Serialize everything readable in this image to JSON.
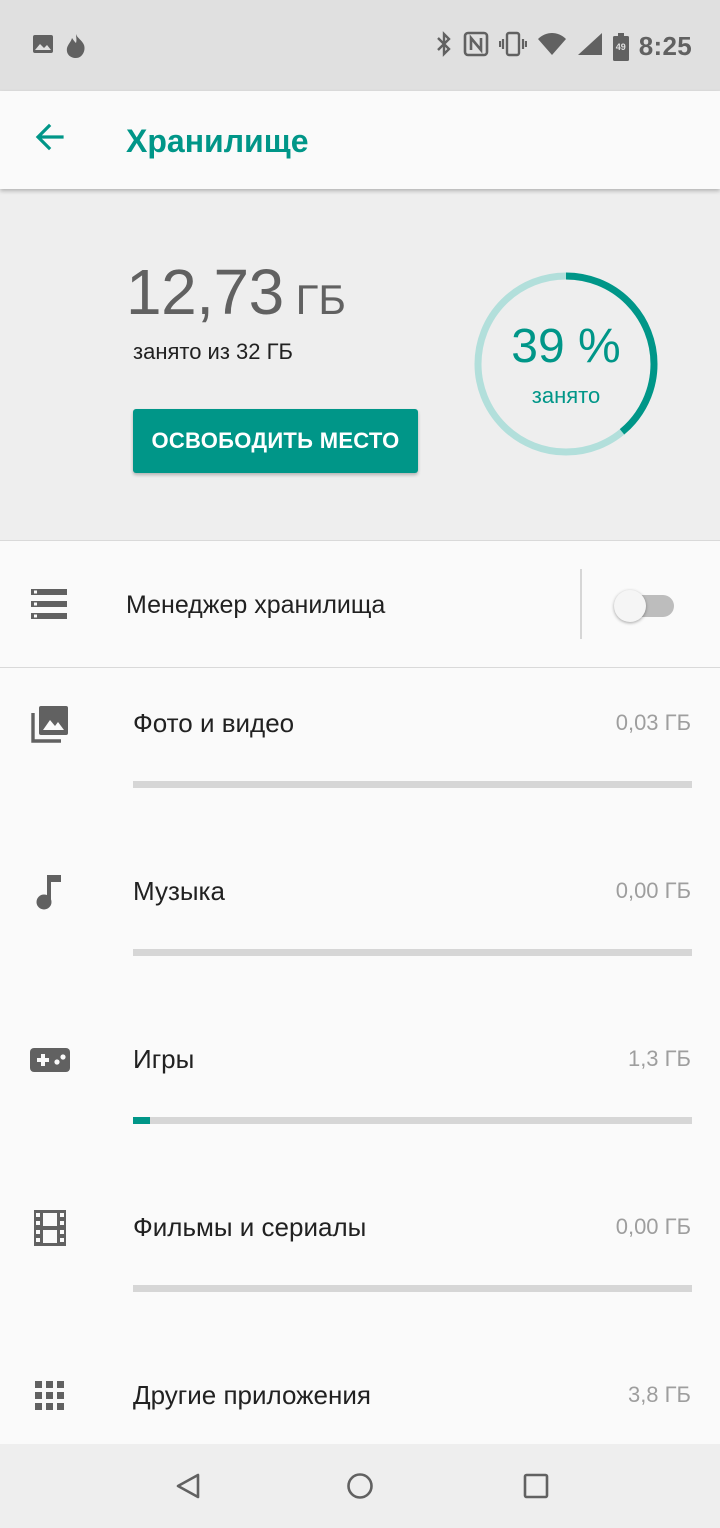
{
  "status_bar": {
    "time": "8:25",
    "battery_level": "49",
    "icons_left": [
      "image-icon",
      "fire-icon"
    ],
    "icons_right": [
      "bluetooth-icon",
      "nfc-icon",
      "vibrate-icon",
      "wifi-icon",
      "signal-icon",
      "battery-icon"
    ]
  },
  "app_bar": {
    "title": "Хранилище",
    "back_icon": "arrow-back-icon"
  },
  "summary": {
    "used_value": "12,73",
    "used_unit": "ГБ",
    "used_of_total": "занято из 32 ГБ",
    "free_button_label": "ОСВОБОДИТЬ МЕСТО",
    "percent_text": "39 %",
    "percent_label": "занято",
    "percent_used": 39
  },
  "storage_manager": {
    "label": "Менеджер хранилища",
    "icon": "storage-icon",
    "enabled": false
  },
  "categories": [
    {
      "label": "Фото и видео",
      "size": "0,03 ГБ",
      "icon": "photo-library-icon",
      "fill_percent": 0
    },
    {
      "label": "Музыка",
      "size": "0,00 ГБ",
      "icon": "music-note-icon",
      "fill_percent": 0
    },
    {
      "label": "Игры",
      "size": "1,3 ГБ",
      "icon": "gamepad-icon",
      "fill_percent": 3
    },
    {
      "label": "Фильмы и сериалы",
      "size": "0,00 ГБ",
      "icon": "movie-icon",
      "fill_percent": 0
    },
    {
      "label": "Другие приложения",
      "size": "3,8 ГБ",
      "icon": "apps-grid-icon",
      "fill_percent": 0
    }
  ],
  "colors": {
    "accent": "#009688",
    "ring_track": "#b2dfdb",
    "bar_track": "#d6d6d6"
  },
  "nav_bar": {
    "buttons": [
      "back-triangle-icon",
      "home-circle-icon",
      "recents-square-icon"
    ]
  }
}
